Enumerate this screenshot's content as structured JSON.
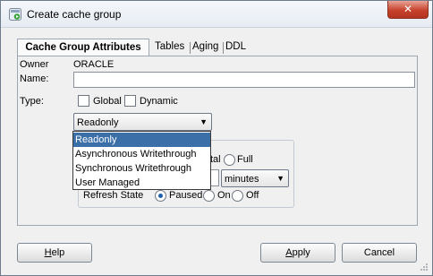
{
  "window": {
    "title": "Create cache group"
  },
  "tabs": [
    {
      "label": "Cache Group Attributes"
    },
    {
      "label": "Tables"
    },
    {
      "label": "Aging"
    },
    {
      "label": "DDL"
    }
  ],
  "form": {
    "owner_label": "Owner",
    "owner_value": "ORACLE",
    "name_label": "Name:",
    "name_value": "",
    "type_label": "Type:",
    "global_label": "Global",
    "dynamic_label": "Dynamic",
    "cache_type_value": "Readonly"
  },
  "dropdown": {
    "options": [
      "Readonly",
      "Asynchronous Writethrough",
      "Synchronous Writethrough",
      "User Managed"
    ],
    "selected_index": 0
  },
  "refresh": {
    "partial_label": "tal",
    "full_label": "Full",
    "interval_unit": "minutes",
    "state_label": "Refresh State",
    "paused_label": "Paused",
    "on_label": "On",
    "off_label": "Off"
  },
  "buttons": {
    "help": {
      "mnemonic": "H",
      "rest": "elp"
    },
    "apply": {
      "mnemonic": "A",
      "rest": "pply"
    },
    "cancel": {
      "label": "Cancel"
    }
  },
  "colors": {
    "selection": "#3b6fa8",
    "close_button": "#c7422d"
  }
}
